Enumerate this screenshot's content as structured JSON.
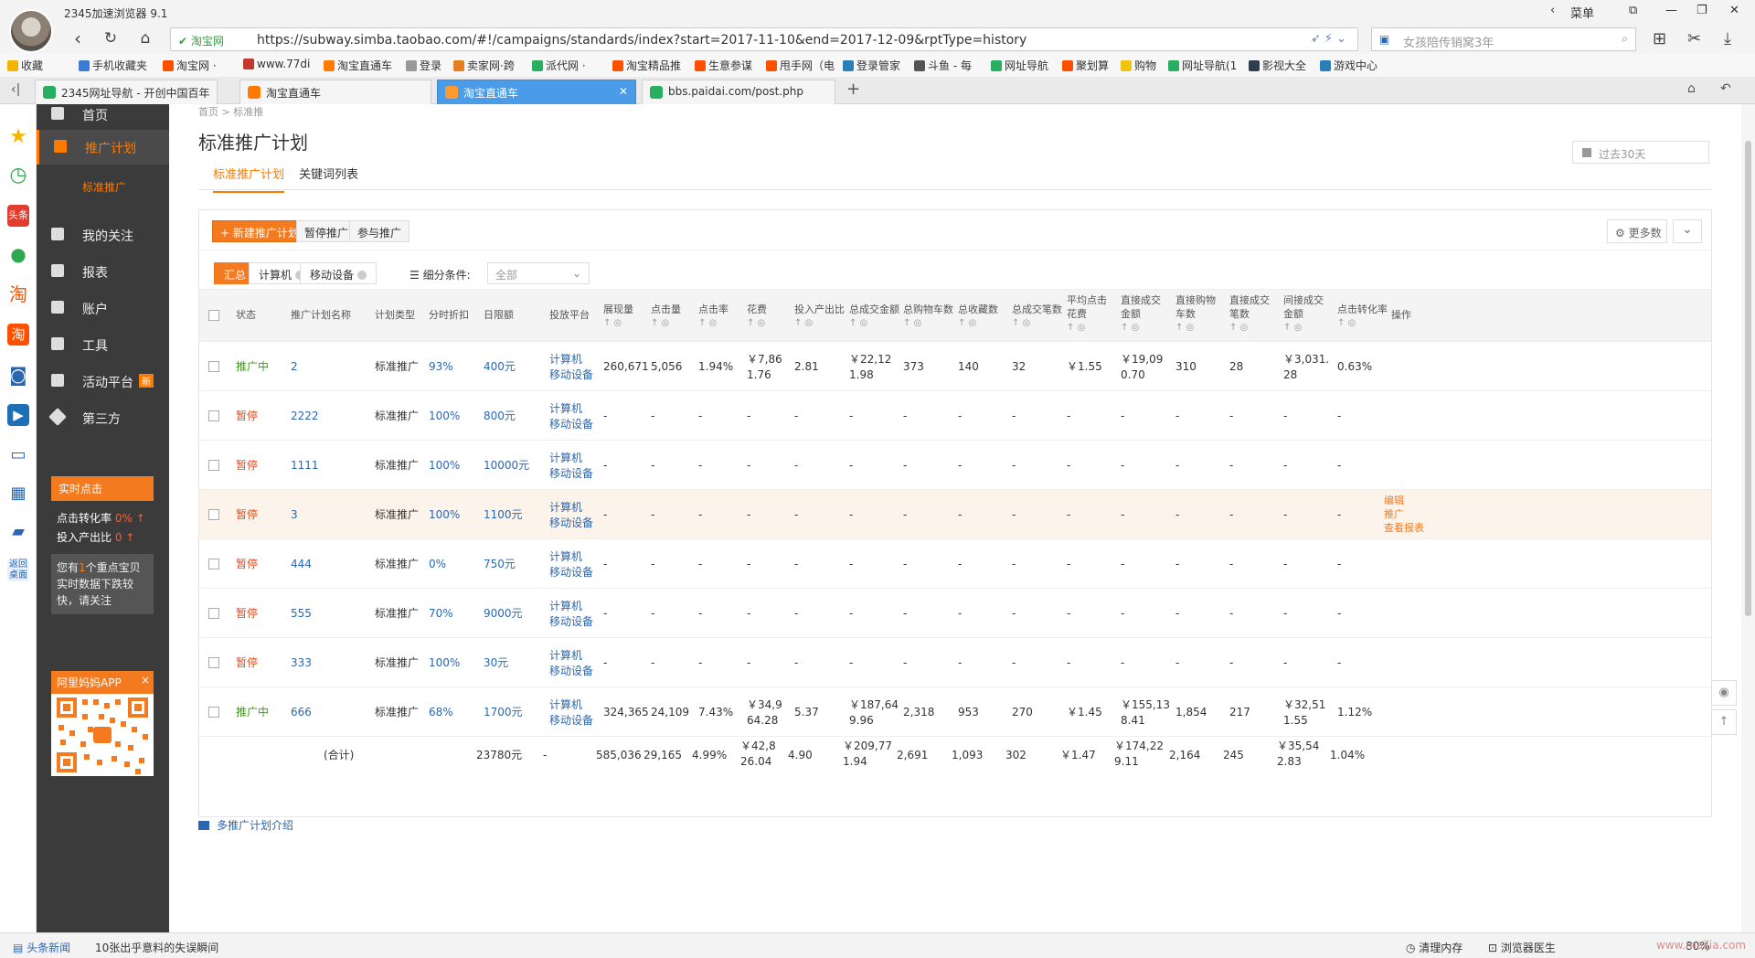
{
  "browser": {
    "app_title": "2345加速浏览器 9.1",
    "menu_label": "菜单",
    "url_secure_label": "淘宝网",
    "url": "https://subway.simba.taobao.com/#!/campaigns/standards/index?start=2017-11-10&end=2017-12-09&rptType=history",
    "search_placeholder": "女孩陪传销窝3年"
  },
  "bookmarks": [
    {
      "label": "收藏",
      "color": "#f5b400"
    },
    {
      "label": "手机收藏夹",
      "color": "#3a7bd5"
    },
    {
      "label": "淘宝网 ·",
      "color": "#ff5000"
    },
    {
      "label": "www.77di",
      "color": "#c0392b"
    },
    {
      "label": "淘宝直通车",
      "color": "#ff7a00"
    },
    {
      "label": "登录",
      "color": "#999999"
    },
    {
      "label": "卖家网·跨",
      "color": "#e67e22"
    },
    {
      "label": "派代网 ·",
      "color": "#27ae60"
    },
    {
      "label": "淘宝精品推",
      "color": "#ff5000"
    },
    {
      "label": "生意参谋",
      "color": "#ff5000"
    },
    {
      "label": "甩手网（电",
      "color": "#ff5000"
    },
    {
      "label": "登录管家",
      "color": "#2980b9"
    },
    {
      "label": "斗鱼 - 每",
      "color": "#555555"
    },
    {
      "label": "网址导航",
      "color": "#27ae60"
    },
    {
      "label": "聚划算",
      "color": "#ff5000"
    },
    {
      "label": "购物",
      "color": "#f1c40f"
    },
    {
      "label": "网址导航(1",
      "color": "#27ae60"
    },
    {
      "label": "影视大全",
      "color": "#2c3e50"
    },
    {
      "label": "游戏中心",
      "color": "#2980b9"
    }
  ],
  "tabs": [
    {
      "label": "2345网址导航 - 开创中国百年",
      "color": "#27ae60"
    },
    {
      "label": "淘宝直通车",
      "color": "#ff7a00"
    },
    {
      "label": "淘宝直通车",
      "color": "#ff7a00",
      "active": true
    },
    {
      "label": "bbs.paidai.com/post.php",
      "color": "#27ae60"
    }
  ],
  "leftnav": {
    "items": [
      "首页",
      "推广计划",
      "我的关注",
      "报表",
      "账户",
      "工具",
      "活动平台",
      "第三方"
    ],
    "sub_item": "标准推广",
    "new_badge": "新",
    "realtime": {
      "title": "实时点击",
      "cvr_label": "点击转化率",
      "cvr_value": "0% ↑",
      "roi_label": "投入产出比",
      "roi_value": "0 ↑",
      "note_pre": "您有",
      "note_num": "1",
      "note_post": "个重点宝贝实时数据下跌较快，请关注"
    },
    "app_promo": {
      "title": "阿里妈妈APP",
      "close": "×"
    }
  },
  "main": {
    "breadcrumb": "首页  >  标准推",
    "title": "标准推广计划",
    "date_range": "过去30天",
    "subtabs": [
      "标准推广计划",
      "关键词列表"
    ],
    "toolbar": {
      "new_plan": "+ 新建推广计划",
      "pause": "暂停推广",
      "join": "参与推广",
      "more": "更多数",
      "more_toggle": "⌄"
    },
    "filter": {
      "segments": [
        "汇总",
        "计算机",
        "移动设备"
      ],
      "label": "细分条件:",
      "select_value": "全部"
    },
    "columns": [
      "状态",
      "推广计划名称",
      "计划类型",
      "分时折扣",
      "日限额",
      "投放平台",
      "展现量",
      "点击量",
      "点击率",
      "花费",
      "投入产出比",
      "总成交金额",
      "总购物车数",
      "总收藏数",
      "总成交笔数",
      "平均点击花费",
      "直接成交金额",
      "直接购物车数",
      "直接成交笔数",
      "间接成交金额",
      "点击转化率",
      "操作"
    ],
    "sort_arrow": "↑ ◎",
    "rows": [
      {
        "status": "推广中",
        "name": "2",
        "type": "标准推广",
        "discount": "93%",
        "budget": "400元",
        "platform": "计算机 移动设备",
        "impr": "260,671",
        "clicks": "5,056",
        "ctr": "1.94%",
        "cost": "￥7,861.76",
        "roi": "2.81",
        "gmv": "￥22,121.98",
        "cart": "373",
        "fav": "140",
        "orders": "32",
        "cpc": "￥1.55",
        "d_gmv": "￥19,090.70",
        "d_cart": "310",
        "d_orders": "28",
        "i_gmv": "￥3,031.28",
        "cvr": "0.63%"
      },
      {
        "status": "暂停",
        "name": "2222",
        "type": "标准推广",
        "discount": "100%",
        "budget": "800元",
        "platform": "计算机 移动设备",
        "impr": "-",
        "clicks": "-",
        "ctr": "-",
        "cost": "-",
        "roi": "-",
        "gmv": "-",
        "cart": "-",
        "fav": "-",
        "orders": "-",
        "cpc": "-",
        "d_gmv": "-",
        "d_cart": "-",
        "d_orders": "-",
        "i_gmv": "-",
        "cvr": "-"
      },
      {
        "status": "暂停",
        "name": "1111",
        "type": "标准推广",
        "discount": "100%",
        "budget": "10000元",
        "platform": "计算机 移动设备",
        "impr": "-",
        "clicks": "-",
        "ctr": "-",
        "cost": "-",
        "roi": "-",
        "gmv": "-",
        "cart": "-",
        "fav": "-",
        "orders": "-",
        "cpc": "-",
        "d_gmv": "-",
        "d_cart": "-",
        "d_orders": "-",
        "i_gmv": "-",
        "cvr": "-"
      },
      {
        "status": "暂停",
        "name": "3",
        "type": "标准推广",
        "discount": "100%",
        "budget": "1100元",
        "platform": "计算机 移动设备",
        "impr": "-",
        "clicks": "-",
        "ctr": "-",
        "cost": "-",
        "roi": "-",
        "gmv": "-",
        "cart": "-",
        "fav": "-",
        "orders": "-",
        "cpc": "-",
        "d_gmv": "-",
        "d_cart": "-",
        "d_orders": "-",
        "i_gmv": "-",
        "cvr": "-",
        "ops": [
          "编辑",
          "推广",
          "查看报表"
        ]
      },
      {
        "status": "暂停",
        "name": "444",
        "type": "标准推广",
        "discount": "0%",
        "budget": "750元",
        "platform": "计算机 移动设备",
        "impr": "-",
        "clicks": "-",
        "ctr": "-",
        "cost": "-",
        "roi": "-",
        "gmv": "-",
        "cart": "-",
        "fav": "-",
        "orders": "-",
        "cpc": "-",
        "d_gmv": "-",
        "d_cart": "-",
        "d_orders": "-",
        "i_gmv": "-",
        "cvr": "-"
      },
      {
        "status": "暂停",
        "name": "555",
        "type": "标准推广",
        "discount": "70%",
        "budget": "9000元",
        "platform": "计算机 移动设备",
        "impr": "-",
        "clicks": "-",
        "ctr": "-",
        "cost": "-",
        "roi": "-",
        "gmv": "-",
        "cart": "-",
        "fav": "-",
        "orders": "-",
        "cpc": "-",
        "d_gmv": "-",
        "d_cart": "-",
        "d_orders": "-",
        "i_gmv": "-",
        "cvr": "-"
      },
      {
        "status": "暂停",
        "name": "333",
        "type": "标准推广",
        "discount": "100%",
        "budget": "30元",
        "platform": "计算机 移动设备",
        "impr": "-",
        "clicks": "-",
        "ctr": "-",
        "cost": "-",
        "roi": "-",
        "gmv": "-",
        "cart": "-",
        "fav": "-",
        "orders": "-",
        "cpc": "-",
        "d_gmv": "-",
        "d_cart": "-",
        "d_orders": "-",
        "i_gmv": "-",
        "cvr": "-"
      },
      {
        "status": "推广中",
        "name": "666",
        "type": "标准推广",
        "discount": "68%",
        "budget": "1700元",
        "platform": "计算机 移动设备",
        "impr": "324,365",
        "clicks": "24,109",
        "ctr": "7.43%",
        "cost": "￥34,964.28",
        "roi": "5.37",
        "gmv": "￥187,649.96",
        "cart": "2,318",
        "fav": "953",
        "orders": "270",
        "cpc": "￥1.45",
        "d_gmv": "￥155,138.41",
        "d_cart": "1,854",
        "d_orders": "217",
        "i_gmv": "￥32,511.55",
        "cvr": "1.12%"
      }
    ],
    "totals": {
      "label": "(合计)",
      "budget": "23780元",
      "platform": "-",
      "impr": "585,036",
      "clicks": "29,165",
      "ctr": "4.99%",
      "cost": "￥42,826.04",
      "roi": "4.90",
      "gmv": "￥209,771.94",
      "cart": "2,691",
      "fav": "1,093",
      "orders": "302",
      "cpc": "￥1.47",
      "d_gmv": "￥174,229.11",
      "d_cart": "2,164",
      "d_orders": "245",
      "i_gmv": "￥35,542.83",
      "cvr": "1.04%"
    },
    "intro_link": "多推广计划介绍"
  },
  "statusbar": {
    "news": "头条新闻",
    "headline": "10张出乎意料的失误瞬间",
    "clean": "清理内存",
    "doctor": "浏览器医生",
    "zoom": "80%",
    "watermark": "www.maijia.com"
  }
}
